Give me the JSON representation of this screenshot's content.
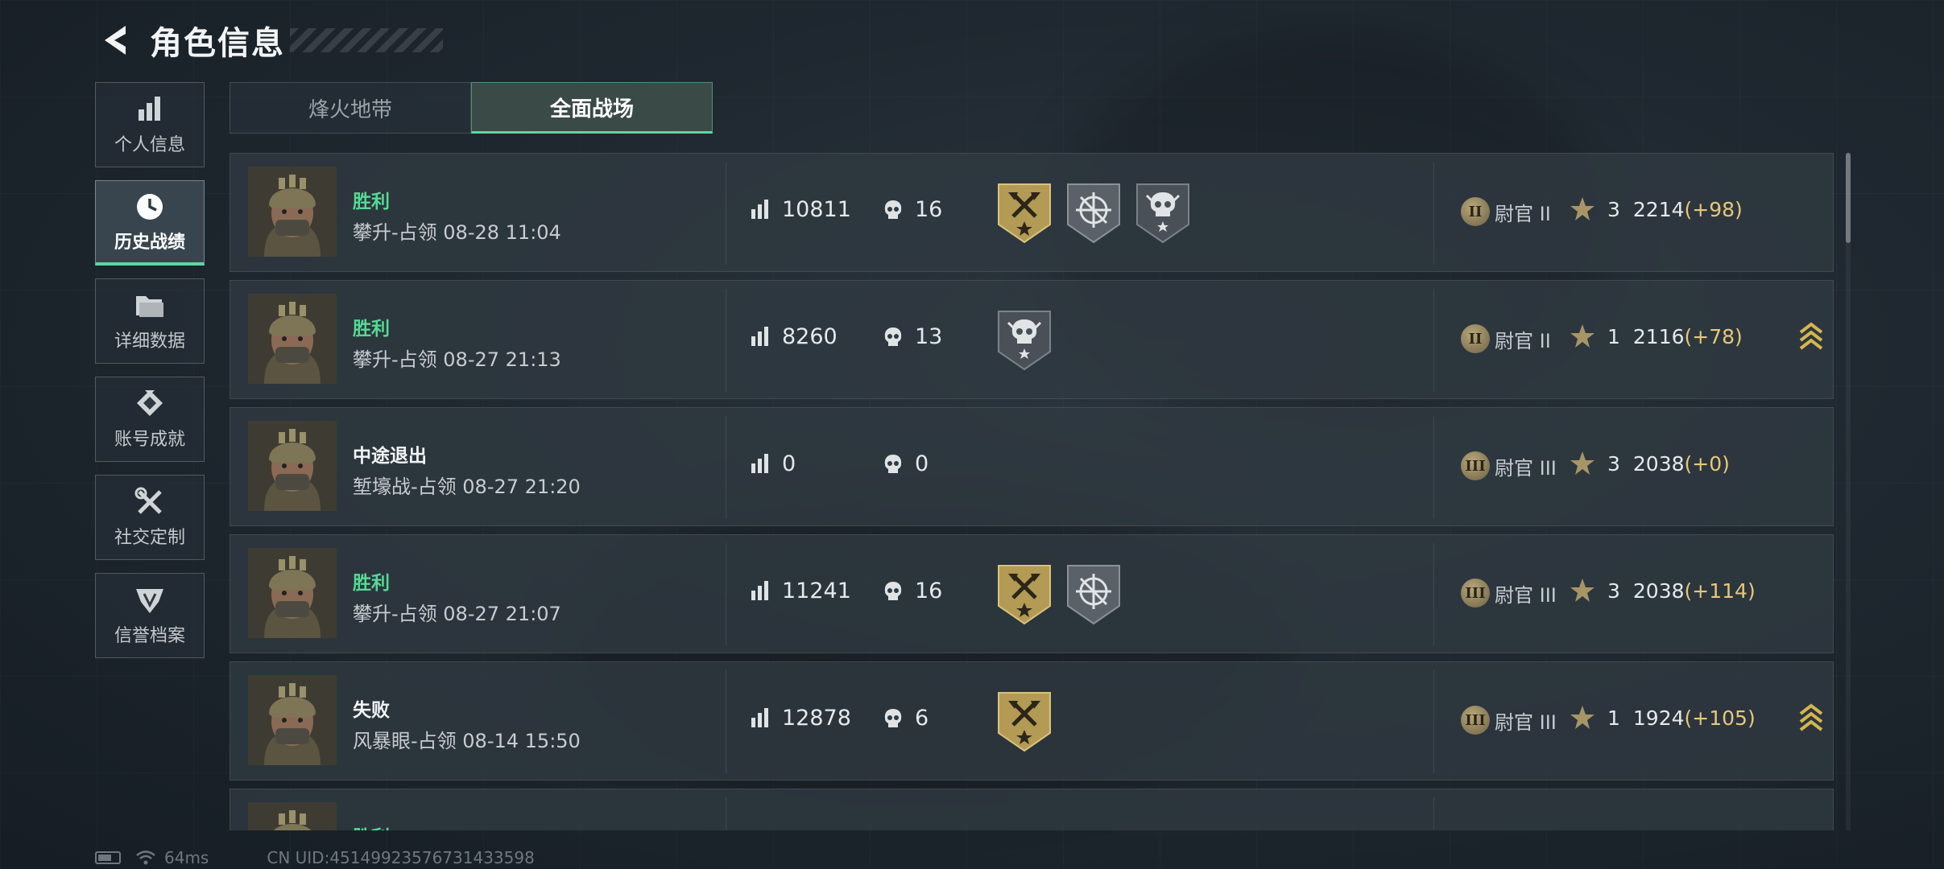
{
  "header": {
    "title": "角色信息"
  },
  "sidebar": {
    "items": [
      {
        "label": "个人信息"
      },
      {
        "label": "历史战绩"
      },
      {
        "label": "详细数据"
      },
      {
        "label": "账号成就"
      },
      {
        "label": "社交定制"
      },
      {
        "label": "信誉档案"
      }
    ]
  },
  "tabs": [
    {
      "label": "烽火地带"
    },
    {
      "label": "全面战场"
    }
  ],
  "active_tab": "全面战场",
  "matches": [
    {
      "result": "胜利",
      "result_type": "win",
      "mode": "攀升-占领 08-28 11:04",
      "score": "10811",
      "kills": "16",
      "badges": [
        "gold-axe-badge",
        "crosshair-badge",
        "skull-badge"
      ],
      "rank_numeral": "II",
      "rank": "尉官 II",
      "stars": "3",
      "points": "2214",
      "delta": "(+98)",
      "promoted": false
    },
    {
      "result": "胜利",
      "result_type": "win",
      "mode": "攀升-占领 08-27 21:13",
      "score": "8260",
      "kills": "13",
      "badges": [
        "skull-badge"
      ],
      "rank_numeral": "II",
      "rank": "尉官 II",
      "stars": "1",
      "points": "2116",
      "delta": "(+78)",
      "promoted": true
    },
    {
      "result": "中途退出",
      "result_type": "loss",
      "mode": "堑壕战-占领 08-27 21:20",
      "score": "0",
      "kills": "0",
      "badges": [],
      "rank_numeral": "III",
      "rank": "尉官 III",
      "stars": "3",
      "points": "2038",
      "delta": "(+0)",
      "promoted": false
    },
    {
      "result": "胜利",
      "result_type": "win",
      "mode": "攀升-占领 08-27 21:07",
      "score": "11241",
      "kills": "16",
      "badges": [
        "gold-axe-badge",
        "crosshair-badge"
      ],
      "rank_numeral": "III",
      "rank": "尉官 III",
      "stars": "3",
      "points": "2038",
      "delta": "(+114)",
      "promoted": false
    },
    {
      "result": "失败",
      "result_type": "loss",
      "mode": "风暴眼-占领 08-14 15:50",
      "score": "12878",
      "kills": "6",
      "badges": [
        "gold-axe-badge"
      ],
      "rank_numeral": "III",
      "rank": "尉官 III",
      "stars": "1",
      "points": "1924",
      "delta": "(+105)",
      "promoted": true
    },
    {
      "result": "胜利",
      "result_type": "win",
      "mode": "",
      "score": "",
      "kills": "",
      "badges": [],
      "rank_numeral": "",
      "rank": "",
      "stars": "",
      "points": "",
      "delta": "",
      "promoted": false
    }
  ],
  "footer": {
    "ping": "64ms",
    "uid": "CN UID:4514992357673143359​8"
  },
  "colors": {
    "accent": "#5fd6a0",
    "win": "#56d994",
    "delta": "#e6c77a",
    "gold": "#b39a55"
  }
}
